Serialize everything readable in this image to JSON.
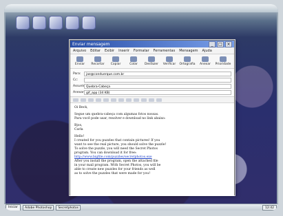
{
  "window": {
    "title": "Enviar mensagem",
    "menu": [
      "Arquivo",
      "Editar",
      "Exibir",
      "Inserir",
      "Formatar",
      "Ferramentas",
      "Mensagem",
      "Ajuda"
    ],
    "toolbar": [
      "Enviar",
      "Recortar",
      "Copiar",
      "Colar",
      "Desfazer",
      "Verificar",
      "Ortografia",
      "Anexar",
      "Prioridade"
    ],
    "headers": [
      {
        "label": "Para:",
        "value": "jae@conduerque.com.br"
      },
      {
        "label": "Cc:",
        "value": ""
      },
      {
        "label": "Assunto:",
        "value": "Quebra-Cabeça"
      },
      {
        "label": "Anexar:",
        "value": "gif_app (34 KB)"
      }
    ],
    "body": [
      "Oi Beck,",
      "",
      "Segue um quebra-cabeça com algumas fotos nossas.",
      "Para você pode usar, resolver e download no link abaixo:",
      "",
      "Bjos,",
      "Carla",
      "",
      "Hello!",
      "I created for you puzzles that contain pictures! If you",
      "want to see the real picture, you should solve the puzzle!",
      "To solve the puzzle, you will need the Secret Photos",
      "program. You can download it for free:",
      "http://www.bigfile.com/puzzles/secretphotos.exe",
      "After you install the program, open the attached file",
      "in your mail program. With Secret Photos, you will be",
      "able to create new puzzles for your friends as well",
      "as to solve the puzzles that were made for you!"
    ]
  },
  "taskbar": {
    "start": "Iniciar",
    "tasks": [
      "Adobe Photoshop",
      "Secretphotos"
    ],
    "tray": "12:42"
  },
  "icons": {
    "desktop": [
      "app-icon",
      "folder-icon",
      "document-icon",
      "browser-icon",
      "media-icon"
    ]
  }
}
